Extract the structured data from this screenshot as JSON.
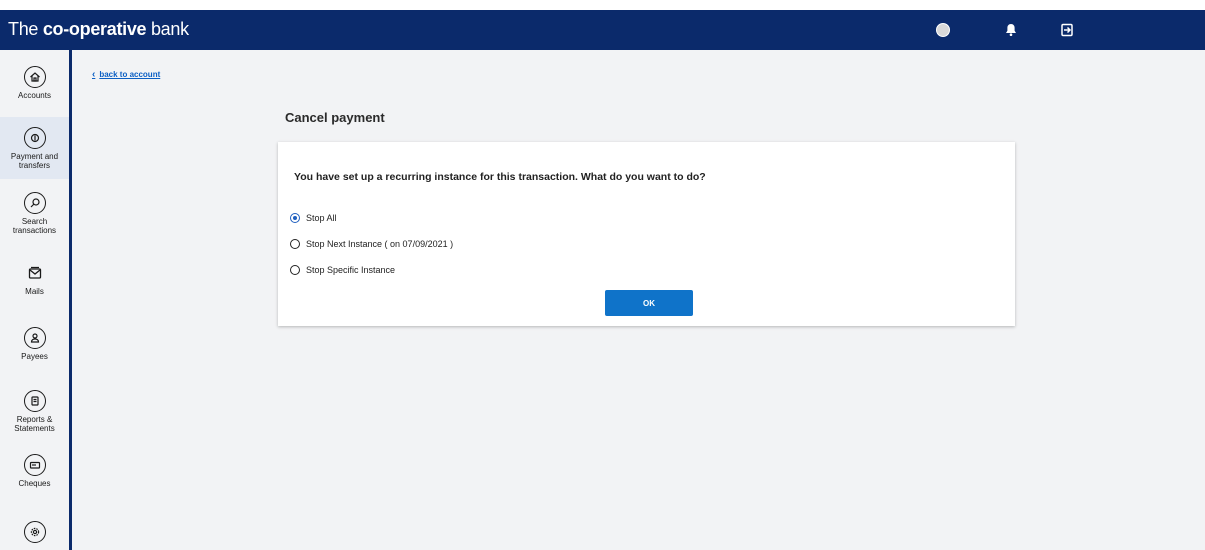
{
  "header": {
    "brand_prefix": "The ",
    "brand_bold": "co-operative",
    "brand_suffix": " bank"
  },
  "nav": {
    "back_label": "back to account",
    "items": [
      {
        "label": "Accounts",
        "icon": "home-icon"
      },
      {
        "label": "Payment and\ntransfers",
        "icon": "payment-icon"
      },
      {
        "label": "Search\ntransactions",
        "icon": "search-icon"
      },
      {
        "label": "Mails",
        "icon": "mail-icon"
      },
      {
        "label": "Payees",
        "icon": "payee-icon"
      },
      {
        "label": "Reports &\nStatements",
        "icon": "reports-icon"
      },
      {
        "label": "Cheques",
        "icon": "cheque-icon"
      },
      {
        "label": "",
        "icon": "settings-icon"
      }
    ]
  },
  "main": {
    "title": "Cancel payment",
    "question": "You have set up a recurring instance for this transaction. What do you want to do?",
    "options": [
      {
        "label": "Stop All",
        "checked": true
      },
      {
        "label": "Stop Next Instance  ( on 07/09/2021 )",
        "checked": false
      },
      {
        "label": "Stop Specific Instance",
        "checked": false
      }
    ],
    "ok_label": "OK"
  },
  "colors": {
    "brand_navy": "#0b2a6b",
    "primary_button": "#0f73c9",
    "link": "#0b5fc4",
    "background": "#f2f3f5"
  }
}
